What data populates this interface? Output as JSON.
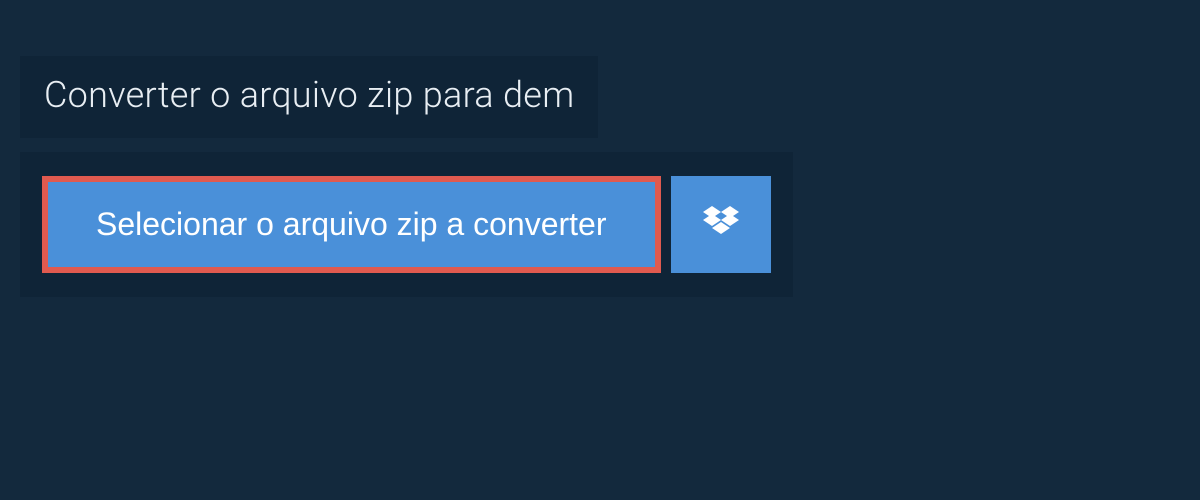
{
  "header": {
    "title": "Converter o arquivo zip para dem"
  },
  "actions": {
    "select_file_label": "Selecionar o arquivo zip a converter"
  },
  "colors": {
    "page_bg": "#13293d",
    "panel_bg": "#0f2437",
    "button_bg": "#4a90d9",
    "highlight_border": "#e05a4f",
    "text_light": "#e8eef3",
    "text_white": "#ffffff"
  }
}
